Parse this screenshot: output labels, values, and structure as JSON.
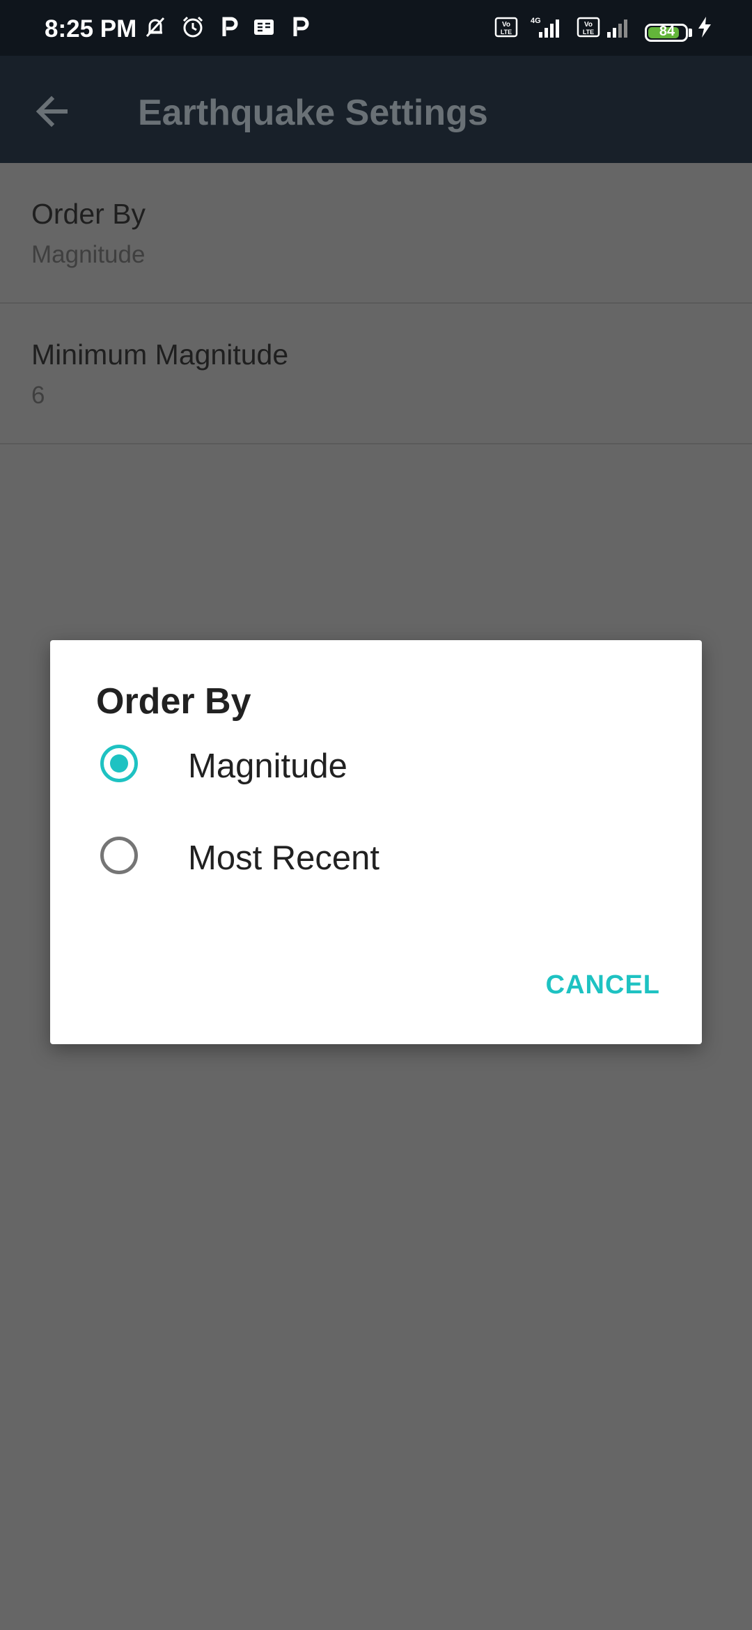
{
  "status_bar": {
    "time": "8:25 PM",
    "battery_level": "84",
    "battery_percent": 84,
    "left_icons": [
      "mute-icon",
      "alarm-icon",
      "paytm-icon",
      "news-icon",
      "paytm-icon"
    ],
    "right_icons": [
      "volte-icon",
      "signal-4g-icon",
      "volte-icon",
      "signal-icon",
      "battery-icon",
      "charging-icon"
    ]
  },
  "app_bar": {
    "title": "Earthquake Settings",
    "back_icon": "arrow-back-icon"
  },
  "settings": [
    {
      "title": "Order By",
      "summary": "Magnitude"
    },
    {
      "title": "Minimum Magnitude",
      "summary": "6"
    }
  ],
  "dialog": {
    "title": "Order By",
    "options": [
      {
        "label": "Magnitude",
        "selected": true
      },
      {
        "label": "Most Recent",
        "selected": false
      }
    ],
    "cancel_label": "CANCEL"
  },
  "colors": {
    "accent": "#1ec2c2",
    "status_bar_bg": "#0f151c",
    "app_bar_bg": "#182029",
    "scrim_bg": "#666666",
    "dialog_bg": "#ffffff",
    "battery_fill": "#63b53a"
  }
}
